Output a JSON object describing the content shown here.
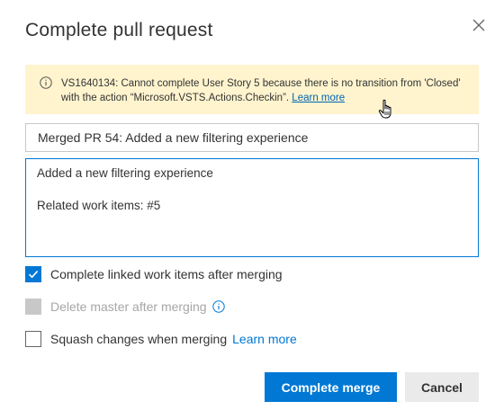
{
  "dialog": {
    "title": "Complete pull request",
    "close_icon": "close-icon"
  },
  "warning": {
    "icon": "info-icon",
    "message": "VS1640134: Cannot complete User Story 5 because there is no transition from 'Closed' with the action “Microsoft.VSTS.Actions.Checkin”.",
    "link_label": "Learn more",
    "background_color": "#fff4ce"
  },
  "form": {
    "title_value": "Merged PR 54: Added a new filtering experience",
    "description_value": "Added a new filtering experience\n\nRelated work items: #5"
  },
  "options": {
    "complete_work_items": {
      "label": "Complete linked work items after merging",
      "checked": true
    },
    "delete_branch": {
      "label": "Delete master after merging",
      "checked": false,
      "disabled": true,
      "icon": "info-icon"
    },
    "squash": {
      "label": "Squash changes when merging",
      "link_label": "Learn more",
      "checked": false
    }
  },
  "actions": {
    "primary_label": "Complete merge",
    "secondary_label": "Cancel"
  },
  "colors": {
    "accent": "#0078d4",
    "link": "#0063b1",
    "disabled": "#c8c8c8"
  }
}
